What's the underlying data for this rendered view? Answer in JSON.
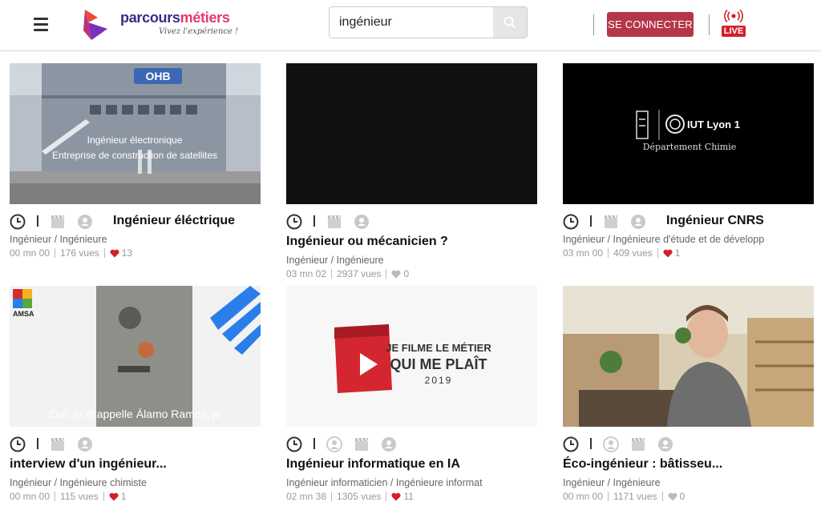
{
  "header": {
    "logo_brand_a": "parcours",
    "logo_brand_b": "métiers",
    "logo_tagline": "Vivez l'expérience !",
    "search_value": "ingénieur",
    "login_label": "SE CONNECTER",
    "live_label": "LIVE"
  },
  "colors": {
    "accent": "#b5364a",
    "live": "#d21f2c",
    "heart_red": "#d21f2c",
    "heart_grey": "#bbbbbb"
  },
  "cards": [
    {
      "title": "Ingénieur éléctrique",
      "category": "Ingénieur / Ingénieure",
      "duration": "00 mn 00",
      "views": "176 vues",
      "likes": "13",
      "liked": true,
      "overlay1": "Ingénieur électronique",
      "overlay2": "Entreprise de construction de satellites",
      "building_sign": "OHB"
    },
    {
      "title": "Ingénieur ou mécanicien ?",
      "category": "Ingénieur / Ingénieure",
      "duration": "03 mn 02",
      "views": "2937 vues",
      "likes": "0",
      "liked": false
    },
    {
      "title": "Ingénieur CNRS",
      "category": "Ingénieur / Ingénieure d'étude et de développ",
      "duration": "03 mn 00",
      "views": "409 vues",
      "likes": "1",
      "liked": true,
      "overlay1": "IUT Lyon 1",
      "overlay2": "Département Chimie"
    },
    {
      "title": "interview d'un ingénieur...",
      "category": "Ingénieur / Ingénieure chimiste",
      "duration": "00 mn 00",
      "views": "115 vues",
      "likes": "1",
      "liked": true,
      "overlay1": "Oui, je m'appelle Álamo Ramos, je",
      "corner_label": "AMSA"
    },
    {
      "title": "Ingénieur informatique en IA",
      "category": "Ingénieur informaticien / Ingénieure informat",
      "duration": "02 mn 38",
      "views": "1305 vues",
      "likes": "11",
      "liked": true,
      "overlay1": "JE FILME LE MÉTIER",
      "overlay2": "QUI ME PLAÎT",
      "overlay3": "2019"
    },
    {
      "title": "Éco-ingénieur : bâtisseu...",
      "category": "Ingénieur / Ingénieure",
      "duration": "00 mn 00",
      "views": "1171 vues",
      "likes": "0",
      "liked": false
    }
  ]
}
